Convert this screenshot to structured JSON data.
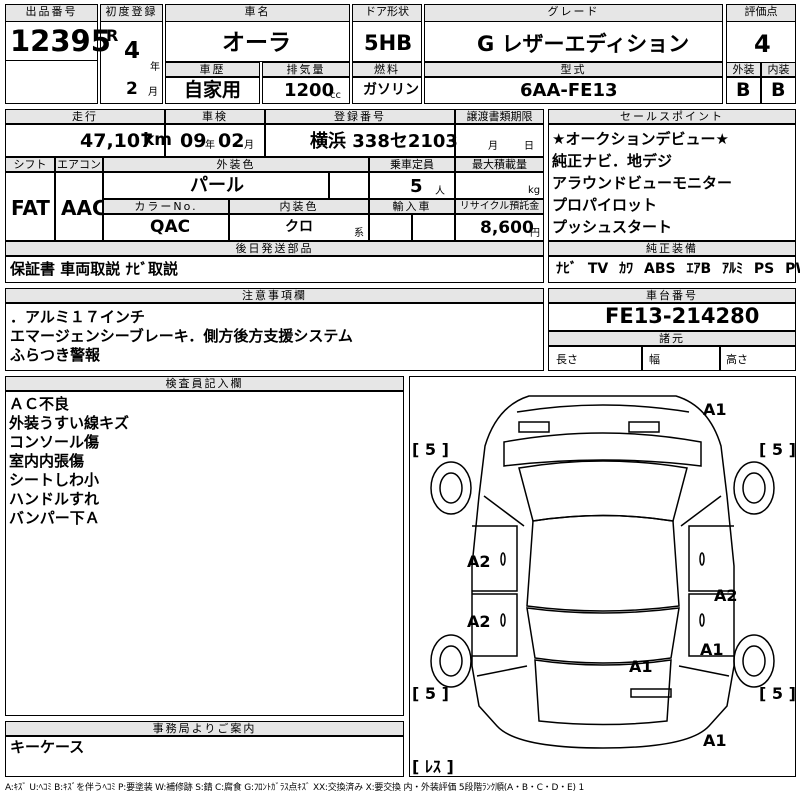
{
  "header": {
    "lot_no_label": "出品番号",
    "lot_no": "12395",
    "first_reg_label": "初度登録",
    "era": "R",
    "year": "4",
    "year_unit": "年",
    "month": "2",
    "month_unit": "月",
    "name_label": "車名",
    "name": "オーラ",
    "door_label": "ドア形状",
    "door": "5HB",
    "grade_label": "グレード",
    "grade": "G レザーエディション",
    "score_label": "評価点",
    "score": "4",
    "history_label": "車歴",
    "history": "自家用",
    "disp_label": "排気量",
    "disp": "1200",
    "disp_unit": "cc",
    "fuel_label": "燃料",
    "fuel": "ガソリン",
    "model_label": "型式",
    "model": "6AA-FE13",
    "ext_label": "外装",
    "ext": "B",
    "int_label": "内装",
    "int": "B"
  },
  "row2": {
    "mileage_label": "走行",
    "mileage": "47,107",
    "mileage_unit": "km",
    "inspection_label": "車検",
    "insp_y": "09",
    "insp_y_unit": "年",
    "insp_m": "02",
    "insp_m_unit": "月",
    "reg_label": "登録番号",
    "reg": "横浜 338セ2103",
    "transfer_label": "譲渡書類期限",
    "transfer_m": "月",
    "transfer_d": "日",
    "shift_label": "シフト",
    "shift": "FAT",
    "ac_label": "エアコン",
    "ac": "AAC",
    "ext_color_label": "外装色",
    "ext_color": "パール",
    "capacity_label": "乗車定員",
    "capacity": "5",
    "capacity_unit": "人",
    "load_label": "最大積載量",
    "load_unit": "kg",
    "color_no_label": "カラーNo.",
    "color_no": "QAC",
    "int_color_label": "内装色",
    "int_color": "クロ",
    "int_color_code": "系",
    "import_label": "輸入車",
    "recycle_label": "リサイクル預託金",
    "recycle": "8,600",
    "recycle_unit": "円"
  },
  "sales_points": {
    "label": "セールスポイント",
    "items": [
      "★オークションデビュー★",
      "純正ナビ．地デジ",
      "アラウンドビューモニター",
      "プロパイロット",
      "プッシュスタート"
    ]
  },
  "later_parts": {
    "label": "後日発送部品",
    "text": "保証書 車両取説 ﾅﾋﾞ取説"
  },
  "equipment": {
    "label": "純正装備",
    "items": [
      "ﾅﾋﾞ",
      "TV",
      "ｶﾜ",
      "ABS",
      "ｴｱB",
      "ｱﾙﾐ",
      "PS",
      "PW"
    ]
  },
  "notes": {
    "label": "注意事項欄",
    "lines": [
      "．アルミ１７インチ",
      "エマージェンシーブレーキ．側方後方支援システム",
      "ふらつき警報"
    ]
  },
  "chassis": {
    "label": "車台番号",
    "value": "FE13-214280"
  },
  "specs": {
    "label": "諸元",
    "length": "長さ",
    "width": "幅",
    "height": "高さ"
  },
  "inspector": {
    "label": "検査員記入欄",
    "lines": [
      "ＡＣ不良",
      "外装うすい線キズ",
      "コンソール傷",
      "室内内張傷",
      "シートしわ小",
      "ハンドルすれ",
      "バンパー下Ａ"
    ]
  },
  "office": {
    "label": "事務局よりご案内",
    "text": "キーケース"
  },
  "diagram": {
    "tires": [
      "[ 5 ]",
      "[ 5 ]",
      "[ 5 ]",
      "[ 5 ]"
    ],
    "spare": "[ ﾚｽ ]",
    "marks": [
      "A1",
      "A2",
      "A2",
      "A2",
      "A1",
      "A1",
      "A1"
    ]
  },
  "legend": "A:ｷｽﾞ U:ﾍｺﾐ B:ｷｽﾞを伴うﾍｺﾐ P:要塗装 W:補修跡 S:錆 C:腐食 G:ﾌﾛﾝﾄｶﾞﾗｽ点ｷｽﾞ XX:交換済み X:要交換 内・外装評価 5段階ﾗﾝｸ順(A・B・C・D・E) 1"
}
